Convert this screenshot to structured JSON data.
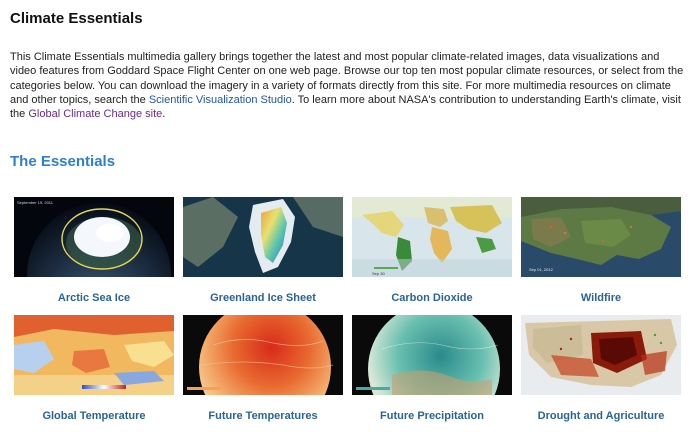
{
  "header": {
    "title": "Climate Essentials"
  },
  "intro": {
    "text_1": "This Climate Essentials multimedia gallery brings together the latest and most popular climate-related images, data visualizations and video features from Goddard Space Flight Center on one web page. Browse our top ten most popular climate resources, or select from the categories below. You can download the imagery in a variety of formats directly from this site. For more multimedia resources on climate and other topics, search the ",
    "link_svs": "Scientific Visualization Studio",
    "text_2": ". To learn more about NASA's contribution to understanding Earth's climate, visit the ",
    "link_gcc": "Global Climate Change site",
    "text_3": "."
  },
  "essentials": {
    "heading": "The Essentials",
    "items": [
      {
        "label": "Arctic Sea Ice",
        "thumb_icon": "arctic-sea-ice-thumbnail",
        "caption": "September 15, 2011"
      },
      {
        "label": "Greenland Ice Sheet",
        "thumb_icon": "greenland-ice-sheet-thumbnail"
      },
      {
        "label": "Carbon Dioxide",
        "thumb_icon": "carbon-dioxide-map-thumbnail",
        "caption": "Sep 30"
      },
      {
        "label": "Wildfire",
        "thumb_icon": "wildfire-map-thumbnail",
        "caption": "Sep 01, 2012"
      },
      {
        "label": "Global Temperature",
        "thumb_icon": "global-temperature-map-thumbnail"
      },
      {
        "label": "Future Temperatures",
        "thumb_icon": "future-temperatures-globe-thumbnail"
      },
      {
        "label": "Future Precipitation",
        "thumb_icon": "future-precipitation-globe-thumbnail"
      },
      {
        "label": "Drought and Agriculture",
        "thumb_icon": "drought-agriculture-map-thumbnail"
      }
    ]
  }
}
